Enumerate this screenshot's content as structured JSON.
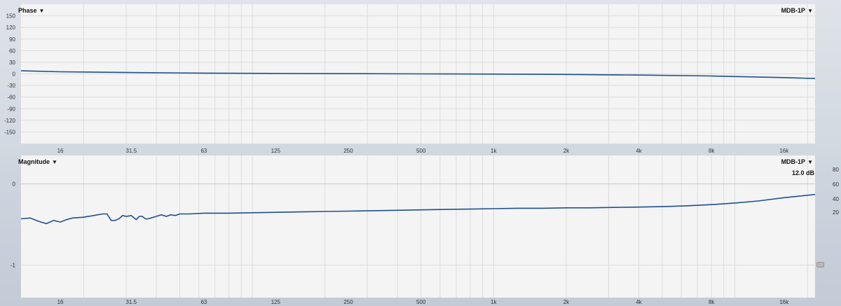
{
  "phase_panel": {
    "title": "Phase",
    "device": "MDB-1P"
  },
  "magnitude_panel": {
    "title": "Magnitude",
    "device": "MDB-1P",
    "offset_label": "12.0 dB"
  },
  "colors": {
    "trace": "#1f4f8f",
    "grid": "#dcdcdc",
    "plot_bg": "#f4f4f4",
    "separator": "#e8423f"
  },
  "chart_data": [
    {
      "type": "line",
      "title": "Phase",
      "x_scale": "log",
      "xlim": [
        11,
        21500
      ],
      "ylim": [
        -180,
        180
      ],
      "x_ticks": [
        "16",
        "31.5",
        "63",
        "125",
        "250",
        "500",
        "1k",
        "2k",
        "4k",
        "8k",
        "16k"
      ],
      "x_tick_values": [
        16,
        31.5,
        63,
        125,
        250,
        500,
        1000,
        2000,
        4000,
        8000,
        16000
      ],
      "y_ticks": [
        150,
        120,
        90,
        60,
        30,
        0,
        -30,
        -60,
        -90,
        -120,
        -150
      ],
      "grid": true,
      "series": [
        {
          "name": "MDB-1P",
          "x": [
            11,
            16,
            31.5,
            63,
            125,
            250,
            500,
            1000,
            2000,
            4000,
            8000,
            16000,
            21500
          ],
          "y": [
            8,
            5.5,
            3.5,
            2,
            1,
            0.5,
            0,
            -0.5,
            -1.5,
            -3,
            -5.5,
            -9.5,
            -12
          ]
        }
      ]
    },
    {
      "type": "line",
      "title": "Magnitude",
      "x_scale": "log",
      "xlim": [
        11,
        21500
      ],
      "ylim": [
        -1.4,
        0.35
      ],
      "x_ticks": [
        "16",
        "31.5",
        "63",
        "125",
        "250",
        "500",
        "1k",
        "2k",
        "4k",
        "8k",
        "16k"
      ],
      "x_tick_values": [
        16,
        31.5,
        63,
        125,
        250,
        500,
        1000,
        2000,
        4000,
        8000,
        16000
      ],
      "y_ticks": [
        0,
        -1
      ],
      "right_y_ticks": [
        80,
        60,
        40,
        20
      ],
      "grid": true,
      "series": [
        {
          "name": "MDB-1P",
          "x": [
            11,
            12,
            13,
            14,
            15,
            16,
            17,
            18,
            20,
            22,
            24,
            25,
            26,
            27,
            28,
            29,
            30,
            31.5,
            33,
            34,
            35,
            36,
            37,
            38,
            40,
            42,
            44,
            46,
            48,
            50,
            55,
            63,
            80,
            100,
            125,
            160,
            200,
            250,
            315,
            400,
            500,
            630,
            800,
            1000,
            1250,
            1600,
            2000,
            2500,
            3150,
            4000,
            5000,
            6300,
            8000,
            10000,
            12500,
            16000,
            21500
          ],
          "y": [
            -0.43,
            -0.42,
            -0.46,
            -0.49,
            -0.45,
            -0.47,
            -0.44,
            -0.42,
            -0.41,
            -0.39,
            -0.37,
            -0.37,
            -0.45,
            -0.45,
            -0.43,
            -0.39,
            -0.4,
            -0.39,
            -0.44,
            -0.4,
            -0.4,
            -0.43,
            -0.43,
            -0.42,
            -0.4,
            -0.38,
            -0.4,
            -0.38,
            -0.39,
            -0.37,
            -0.37,
            -0.36,
            -0.36,
            -0.355,
            -0.35,
            -0.345,
            -0.34,
            -0.335,
            -0.33,
            -0.325,
            -0.32,
            -0.315,
            -0.31,
            -0.305,
            -0.3,
            -0.3,
            -0.295,
            -0.295,
            -0.29,
            -0.285,
            -0.28,
            -0.27,
            -0.255,
            -0.235,
            -0.21,
            -0.17,
            -0.13
          ]
        }
      ]
    }
  ]
}
